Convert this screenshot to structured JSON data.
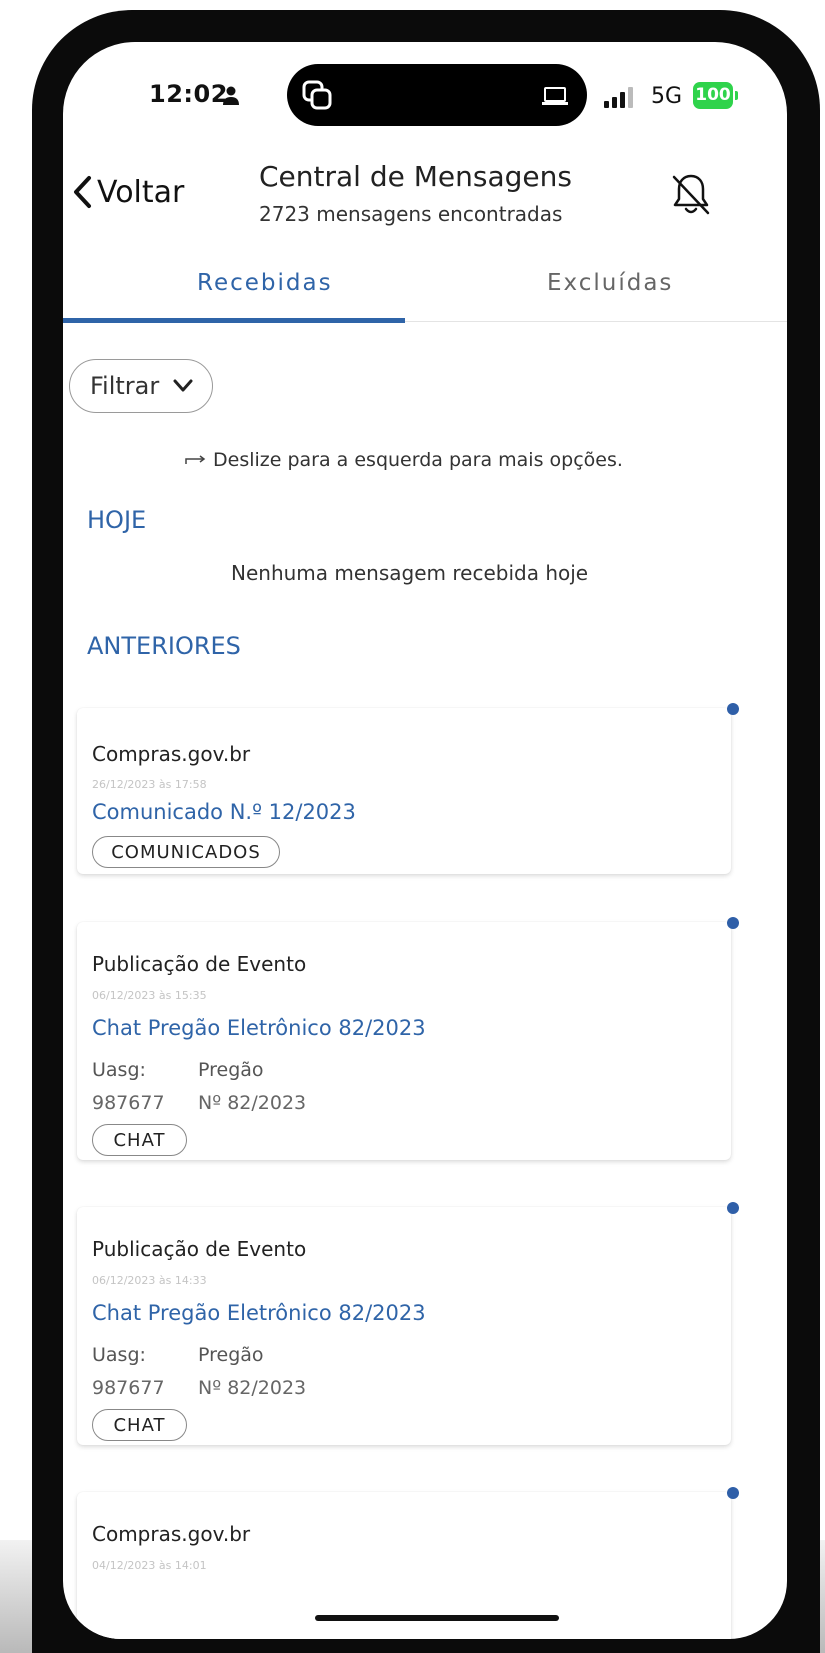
{
  "status_bar": {
    "time": "12:02",
    "network": "5G",
    "battery": "100"
  },
  "header": {
    "back_label": "Voltar",
    "title": "Central de Mensagens",
    "subtitle": "2723 mensagens encontradas"
  },
  "tabs": [
    {
      "label": "Recebidas",
      "active": true
    },
    {
      "label": "Excluídas",
      "active": false
    }
  ],
  "filter": {
    "label": "Filtrar"
  },
  "swipe_hint": "Deslize para a esquerda para mais opções.",
  "sections": {
    "today": {
      "title": "HOJE",
      "empty_text": "Nenhuma mensagem recebida hoje"
    },
    "previous": {
      "title": "ANTERIORES"
    }
  },
  "messages": [
    {
      "sender": "Compras.gov.br",
      "date": "26/12/2023 às 17:58",
      "subject": "Comunicado N.º 12/2023",
      "tag": "COMUNICADOS",
      "unread": true
    },
    {
      "sender": "Publicação de Evento",
      "date": "06/12/2023 às 15:35",
      "subject": "Chat Pregão Eletrônico 82/2023",
      "uasg_label": "Uasg:",
      "uasg_value": "987677",
      "pregao_label": "Pregão",
      "pregao_value": "Nº 82/2023",
      "tag": "CHAT",
      "unread": true
    },
    {
      "sender": "Publicação de Evento",
      "date": "06/12/2023 às 14:33",
      "subject": "Chat Pregão Eletrônico 82/2023",
      "uasg_label": "Uasg:",
      "uasg_value": "987677",
      "pregao_label": "Pregão",
      "pregao_value": "Nº 82/2023",
      "tag": "CHAT",
      "unread": true
    },
    {
      "sender": "Compras.gov.br",
      "date": "04/12/2023 às 14:01",
      "unread": true
    }
  ],
  "colors": {
    "accent": "#2f64a8",
    "unread_dot": "#2f5fa8",
    "battery": "#2fd34b"
  }
}
